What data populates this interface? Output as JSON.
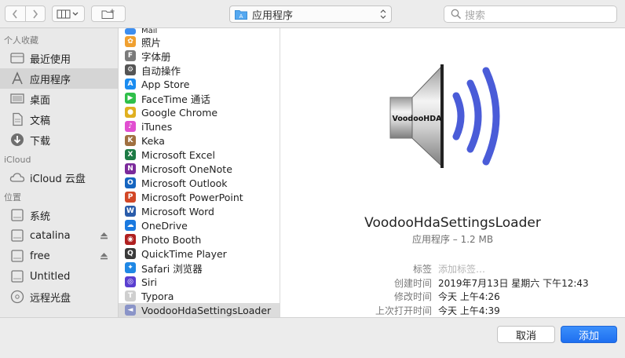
{
  "toolbar": {
    "location_label": "应用程序",
    "search_placeholder": "搜索"
  },
  "sidebar": {
    "sections": [
      {
        "title": "个人收藏",
        "items": [
          {
            "label": "最近使用",
            "icon": "clock-icon"
          },
          {
            "label": "应用程序",
            "icon": "applications-icon",
            "selected": true
          },
          {
            "label": "桌面",
            "icon": "desktop-icon"
          },
          {
            "label": "文稿",
            "icon": "document-icon"
          },
          {
            "label": "下载",
            "icon": "download-icon"
          }
        ]
      },
      {
        "title": "iCloud",
        "items": [
          {
            "label": "iCloud 云盘",
            "icon": "cloud-icon"
          }
        ]
      },
      {
        "title": "位置",
        "items": [
          {
            "label": "系统",
            "icon": "disk-icon"
          },
          {
            "label": "catalina",
            "icon": "disk-icon",
            "eject": true
          },
          {
            "label": "free",
            "icon": "disk-icon",
            "eject": true
          },
          {
            "label": "Untitled",
            "icon": "disk-icon"
          },
          {
            "label": "远程光盘",
            "icon": "optical-disc-icon"
          }
        ]
      }
    ]
  },
  "files": {
    "partial_top": "Mail",
    "items": [
      {
        "name": "照片",
        "color": "#f0a030",
        "glyph": "✿"
      },
      {
        "name": "字体册",
        "color": "#7b7b7b",
        "glyph": "F"
      },
      {
        "name": "自动操作",
        "color": "#555555",
        "glyph": "⚙"
      },
      {
        "name": "App Store",
        "color": "#1a8cf0",
        "glyph": "A"
      },
      {
        "name": "FaceTime 通话",
        "color": "#2fbf4a",
        "glyph": "▶"
      },
      {
        "name": "Google Chrome",
        "color": "#e0b020",
        "glyph": "●"
      },
      {
        "name": "iTunes",
        "color": "#e14fd0",
        "glyph": "♪"
      },
      {
        "name": "Keka",
        "color": "#a07040",
        "glyph": "K"
      },
      {
        "name": "Microsoft Excel",
        "color": "#1d7b45",
        "glyph": "X"
      },
      {
        "name": "Microsoft OneNote",
        "color": "#7b2a9b",
        "glyph": "N"
      },
      {
        "name": "Microsoft Outlook",
        "color": "#1565c0",
        "glyph": "O"
      },
      {
        "name": "Microsoft PowerPoint",
        "color": "#d24726",
        "glyph": "P"
      },
      {
        "name": "Microsoft Word",
        "color": "#2a5caa",
        "glyph": "W"
      },
      {
        "name": "OneDrive",
        "color": "#1b7ae0",
        "glyph": "☁"
      },
      {
        "name": "Photo Booth",
        "color": "#b02020",
        "glyph": "◉"
      },
      {
        "name": "QuickTime Player",
        "color": "#3a3a3a",
        "glyph": "Q"
      },
      {
        "name": "Safari 浏览器",
        "color": "#1f88e5",
        "glyph": "✦"
      },
      {
        "name": "Siri",
        "color": "#5a3fd0",
        "glyph": "◎"
      },
      {
        "name": "Typora",
        "color": "#cfcfcf",
        "glyph": "T"
      },
      {
        "name": "VoodooHdaSettingsLoader",
        "color": "#8a94c8",
        "glyph": "◄",
        "selected": true
      }
    ]
  },
  "preview": {
    "icon_label": "VoodooHDA",
    "name": "VoodooHdaSettingsLoader",
    "kind": "应用程序 – 1.2 MB",
    "meta": [
      {
        "key": "标签",
        "value": "添加标签…",
        "placeholder": true
      },
      {
        "key": "创建时间",
        "value": "2019年7月13日 星期六 下午12:43"
      },
      {
        "key": "修改时间",
        "value": "今天 上午4:26"
      },
      {
        "key": "上次打开时间",
        "value": "今天 上午4:39"
      }
    ]
  },
  "buttons": {
    "cancel": "取消",
    "add": "添加"
  }
}
